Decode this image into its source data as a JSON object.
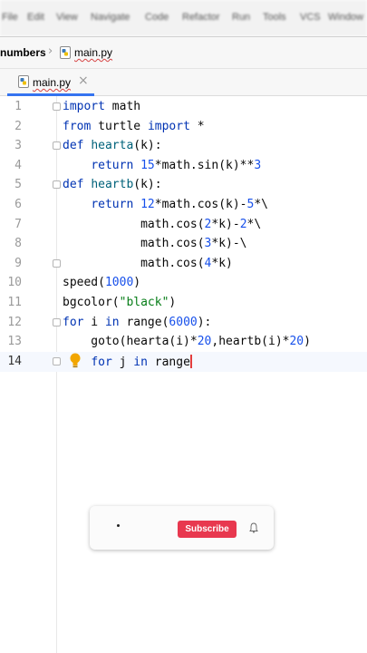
{
  "menu": [
    "File",
    "Edit",
    "View",
    "Navigate",
    "Code",
    "Refactor",
    "Run",
    "Tools",
    "VCS",
    "Window"
  ],
  "breadcrumb": {
    "project": "numbers",
    "file": "main.py"
  },
  "tabs": [
    {
      "label": "main.py",
      "active": true
    }
  ],
  "editor": {
    "current_line": 14,
    "lines": [
      {
        "n": "1",
        "parts": [
          {
            "t": "import",
            "c": "kw"
          },
          {
            "t": " math"
          }
        ]
      },
      {
        "n": "2",
        "parts": [
          {
            "t": "from",
            "c": "kw"
          },
          {
            "t": " turtle "
          },
          {
            "t": "import",
            "c": "kw"
          },
          {
            "t": " *"
          }
        ]
      },
      {
        "n": "3",
        "parts": [
          {
            "t": "def",
            "c": "kw"
          },
          {
            "t": " "
          },
          {
            "t": "hearta",
            "c": "fn"
          },
          {
            "t": "(k):"
          }
        ]
      },
      {
        "n": "4",
        "parts": [
          {
            "t": "    "
          },
          {
            "t": "return",
            "c": "kw"
          },
          {
            "t": " "
          },
          {
            "t": "15",
            "c": "num"
          },
          {
            "t": "*math.sin(k)**"
          },
          {
            "t": "3",
            "c": "num"
          }
        ]
      },
      {
        "n": "5",
        "parts": [
          {
            "t": "def",
            "c": "kw"
          },
          {
            "t": " "
          },
          {
            "t": "heartb",
            "c": "fn"
          },
          {
            "t": "(k):"
          }
        ]
      },
      {
        "n": "6",
        "parts": [
          {
            "t": "    "
          },
          {
            "t": "return",
            "c": "kw"
          },
          {
            "t": " "
          },
          {
            "t": "12",
            "c": "num"
          },
          {
            "t": "*math.cos(k)-"
          },
          {
            "t": "5",
            "c": "num"
          },
          {
            "t": "*\\"
          }
        ]
      },
      {
        "n": "7",
        "parts": [
          {
            "t": "           math.cos("
          },
          {
            "t": "2",
            "c": "num"
          },
          {
            "t": "*k)-"
          },
          {
            "t": "2",
            "c": "num"
          },
          {
            "t": "*\\"
          }
        ]
      },
      {
        "n": "8",
        "parts": [
          {
            "t": "           math.cos("
          },
          {
            "t": "3",
            "c": "num"
          },
          {
            "t": "*k)-\\"
          }
        ]
      },
      {
        "n": "9",
        "parts": [
          {
            "t": "           math.cos("
          },
          {
            "t": "4",
            "c": "num"
          },
          {
            "t": "*k)"
          }
        ]
      },
      {
        "n": "10",
        "parts": [
          {
            "t": "speed("
          },
          {
            "t": "1000",
            "c": "num"
          },
          {
            "t": ")"
          }
        ]
      },
      {
        "n": "11",
        "parts": [
          {
            "t": "bgcolor("
          },
          {
            "t": "\"black\"",
            "c": "str"
          },
          {
            "t": ")"
          }
        ]
      },
      {
        "n": "12",
        "parts": [
          {
            "t": "for",
            "c": "kw"
          },
          {
            "t": " i "
          },
          {
            "t": "in",
            "c": "kw"
          },
          {
            "t": " range("
          },
          {
            "t": "6000",
            "c": "num"
          },
          {
            "t": "):"
          }
        ]
      },
      {
        "n": "13",
        "parts": [
          {
            "t": "    goto(hearta(i)*"
          },
          {
            "t": "20",
            "c": "num"
          },
          {
            "t": ",heartb(i)*"
          },
          {
            "t": "20",
            "c": "num"
          },
          {
            "t": ")"
          }
        ]
      },
      {
        "n": "14",
        "parts": [
          {
            "t": "    "
          },
          {
            "t": "for",
            "c": "kw"
          },
          {
            "t": " j "
          },
          {
            "t": "in",
            "c": "kw"
          },
          {
            "t": " range"
          }
        ]
      }
    ]
  },
  "popup": {
    "subscribe_label": "Subscribe",
    "bell_icon": "bell-icon"
  },
  "colors": {
    "keyword": "#0033b3",
    "number": "#1750eb",
    "string": "#067d17",
    "function": "#00627a",
    "subscribe": "#e8384f"
  }
}
